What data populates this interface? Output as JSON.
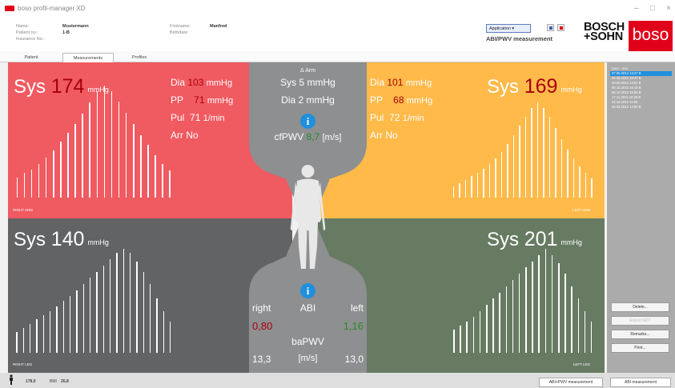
{
  "app": {
    "title": "boso profil-manager XD"
  },
  "header": {
    "name_label": "Name:",
    "name": "Mustermann",
    "patient_label": "Patient no.:",
    "patient": "1-B",
    "insurance_label": "Insurance No.:",
    "firstname_label": "Firstname:",
    "firstname": "Manfred",
    "birthdate_label": "Birthdate:",
    "application_btn": "Application ▾",
    "mode_title": "ABI/PWV measurement",
    "brand_bosch": "BOSCH\n+SOHN",
    "brand_boso": "boso"
  },
  "tabs": [
    "Patient",
    "Measurements",
    "Profiles"
  ],
  "right_arm": {
    "sys_label": "Sys",
    "sys": "174",
    "sys_unit": "mmHg",
    "dia_label": "Dia",
    "dia": "103",
    "pp_label": "PP",
    "pp": "71",
    "pul_label": "Pul",
    "pul": "71",
    "pul_unit": "1/min",
    "arr_label": "Arr",
    "arr": "No",
    "unit": "mmHg",
    "label": "RIGHT ARM",
    "pulse_wave": [
      0.18,
      0.22,
      0.25,
      0.3,
      0.36,
      0.42,
      0.5,
      0.58,
      0.66,
      0.75,
      0.85,
      0.95,
      1.0,
      0.95,
      0.86,
      0.76,
      0.66,
      0.56,
      0.47,
      0.38,
      0.3,
      0.24
    ]
  },
  "left_arm": {
    "sys_label": "Sys",
    "sys": "169",
    "sys_unit": "mmHg",
    "dia_label": "Dia",
    "dia": "101",
    "pp_label": "PP",
    "pp": "68",
    "pul_label": "Pul",
    "pul": "72",
    "pul_unit": "1/min",
    "arr_label": "Arr",
    "arr": "No",
    "unit": "mmHg",
    "label": "LEFT ARM",
    "pulse_wave": [
      0.1,
      0.13,
      0.16,
      0.19,
      0.22,
      0.26,
      0.3,
      0.35,
      0.41,
      0.48,
      0.56,
      0.64,
      0.72,
      0.8,
      0.85,
      0.8,
      0.72,
      0.62,
      0.52,
      0.43,
      0.35,
      0.28,
      0.22,
      0.17
    ]
  },
  "right_leg": {
    "sys_label": "Sys",
    "sys": "140",
    "sys_unit": "mmHg",
    "label": "RIGHT LEG",
    "pulse_wave": [
      0.2,
      0.24,
      0.28,
      0.32,
      0.36,
      0.4,
      0.45,
      0.5,
      0.55,
      0.6,
      0.66,
      0.72,
      0.78,
      0.84,
      0.9,
      0.96,
      1.0,
      0.96,
      0.88,
      0.78,
      0.66,
      0.52,
      0.4,
      0.3
    ]
  },
  "left_leg": {
    "sys_label": "Sys",
    "sys": "201",
    "sys_unit": "mmHg",
    "label": "LEFT LEG",
    "pulse_wave": [
      0.22,
      0.26,
      0.3,
      0.35,
      0.4,
      0.46,
      0.52,
      0.58,
      0.64,
      0.7,
      0.76,
      0.82,
      0.88,
      0.94,
      1.0,
      0.94,
      0.86,
      0.76,
      0.64,
      0.52,
      0.4,
      0.3
    ]
  },
  "center": {
    "delta_label": "Δ Arm",
    "delta_sys": "Sys 5 mmHg",
    "delta_dia": "Dia 2 mmHg",
    "cfpwv_label": "cfPWV",
    "cfpwv": "8,7",
    "cfpwv_unit": "[m/s]",
    "right_label": "right",
    "abi_label": "ABI",
    "left_label": "left",
    "abi_right": "0,80",
    "abi_left": "1,16",
    "bapwv_label": "baPWV",
    "bapwv_unit": "[m/s]",
    "bapwv_right": "13,3",
    "bapwv_left": "13,0"
  },
  "sidebar": {
    "header": "Date - time",
    "items": [
      "07.05.2014 13:27 B",
      "06.05.2014 15:27 B",
      "30.08.2014 13:01 B",
      "06.10.2013 16:15 B",
      "06.10.2013 15:56 B",
      "17.11.2012 10:26 B",
      "23.10.2012 11:06",
      "26.03.2012 14:00 B"
    ],
    "delete": "Delete...",
    "export": "Export GDT",
    "remarks": "Remarks...",
    "print": "Print..."
  },
  "status": {
    "height": "178,0",
    "bmi_label": "BMI",
    "bmi": "26,8",
    "btn_abi_pwv": "ABI+PWV measurement",
    "btn_abi": "ABI measurement"
  },
  "colors": {
    "right_arm": "#f05a61",
    "left_arm": "#ffba4a",
    "right_leg": "#616365",
    "left_leg": "#677b63",
    "info": "#1f8fde"
  },
  "icons": [
    "info-icon",
    "person-icon",
    "minimize-icon",
    "maximize-icon",
    "close-icon",
    "height-icon"
  ]
}
